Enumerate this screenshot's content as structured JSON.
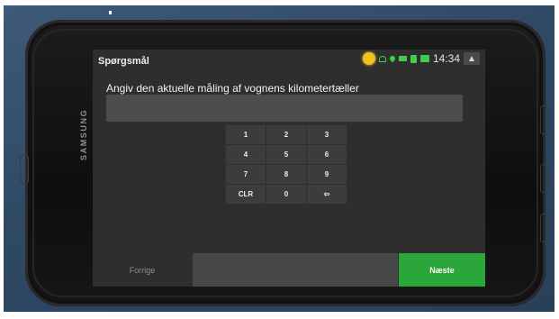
{
  "screen": {
    "title": "Spørgsmål",
    "time": "14:34",
    "prompt": "Angiv den aktuelle måling af vognens kilometertæller",
    "input_value": ""
  },
  "device": {
    "brand": "SAMSUNG"
  },
  "keypad": {
    "keys": [
      "1",
      "2",
      "3",
      "4",
      "5",
      "6",
      "7",
      "8",
      "9",
      "CLR",
      "0",
      "⇦"
    ]
  },
  "footer": {
    "prev_label": "Forrige",
    "next_label": "Næste"
  },
  "colors": {
    "accent_green": "#2aa63a",
    "sun_yellow": "#f3c21b",
    "status_green": "#3fcf4a"
  }
}
